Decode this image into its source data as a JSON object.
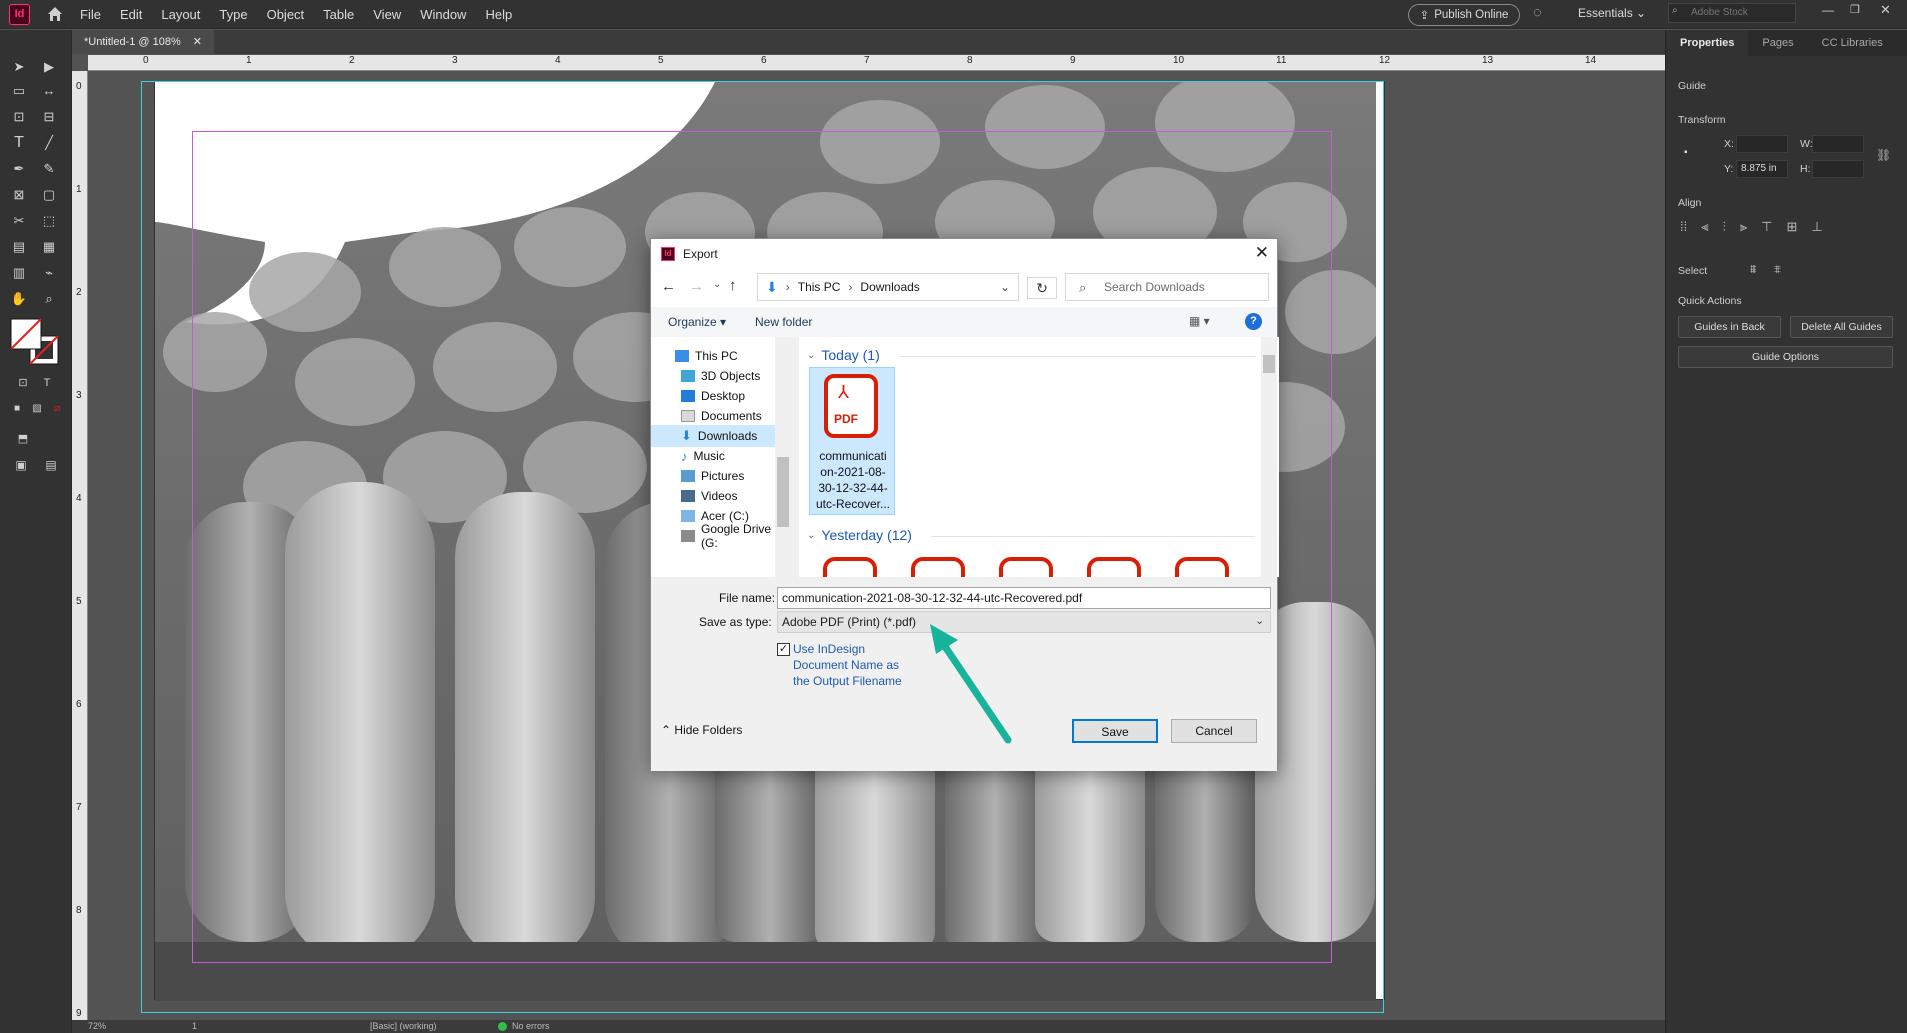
{
  "app": {
    "logo_text": "Id",
    "menu": [
      "File",
      "Edit",
      "Layout",
      "Type",
      "Object",
      "Table",
      "View",
      "Window",
      "Help"
    ],
    "publish_label": "Publish Online",
    "workspace": "Essentials",
    "stock_placeholder": "Adobe Stock"
  },
  "document": {
    "tab_label": "*Untitled-1 @ 108%",
    "h_ruler": [
      "0",
      "1",
      "2",
      "3",
      "4",
      "5",
      "6",
      "7",
      "8",
      "9",
      "10",
      "11",
      "12",
      "13",
      "14"
    ],
    "v_ruler": [
      "0",
      "1",
      "2",
      "3",
      "4",
      "5",
      "6",
      "7",
      "8",
      "9"
    ]
  },
  "panel": {
    "tabs": [
      "Properties",
      "Pages",
      "CC Libraries"
    ],
    "section_guide": "Guide",
    "section_transform": "Transform",
    "x_label": "X:",
    "w_label": "W:",
    "y_label": "Y:",
    "y_value": "8.875 in",
    "h_label": "H:",
    "section_align": "Align",
    "section_select": "Select",
    "section_quick": "Quick Actions",
    "btn_guides_back": "Guides in Back",
    "btn_delete_guides": "Delete All Guides",
    "btn_guide_options": "Guide Options"
  },
  "status": {
    "zoom": "72%",
    "page": "1",
    "style": "[Basic] (working)",
    "errors": "No errors"
  },
  "dialog": {
    "title": "Export",
    "path": [
      "This PC",
      "Downloads"
    ],
    "search_placeholder": "Search Downloads",
    "organize": "Organize",
    "new_folder": "New folder",
    "nav_items": [
      "This PC",
      "3D Objects",
      "Desktop",
      "Documents",
      "Downloads",
      "Music",
      "Pictures",
      "Videos",
      "Acer (C:)",
      "Google Drive (G:"
    ],
    "group_today": "Today (1)",
    "group_yesterday": "Yesterday (12)",
    "pdf_label": "PDF",
    "selected_file_lines": [
      "communicati",
      "on-2021-08-",
      "30-12-32-44-",
      "utc-Recover..."
    ],
    "file_name_label": "File name:",
    "file_name_value": "communication-2021-08-30-12-32-44-utc-Recovered.pdf",
    "save_type_label": "Save as type:",
    "save_type_value": "Adobe PDF (Print) (*.pdf)",
    "checkbox_lines": [
      "Use InDesign",
      "Document Name as",
      "the Output Filename"
    ],
    "hide_folders": "Hide Folders",
    "save": "Save",
    "cancel": "Cancel"
  },
  "colors": {
    "accent": "#0078d7",
    "arrow": "#17b39a",
    "pdf_red": "#d81e05"
  }
}
